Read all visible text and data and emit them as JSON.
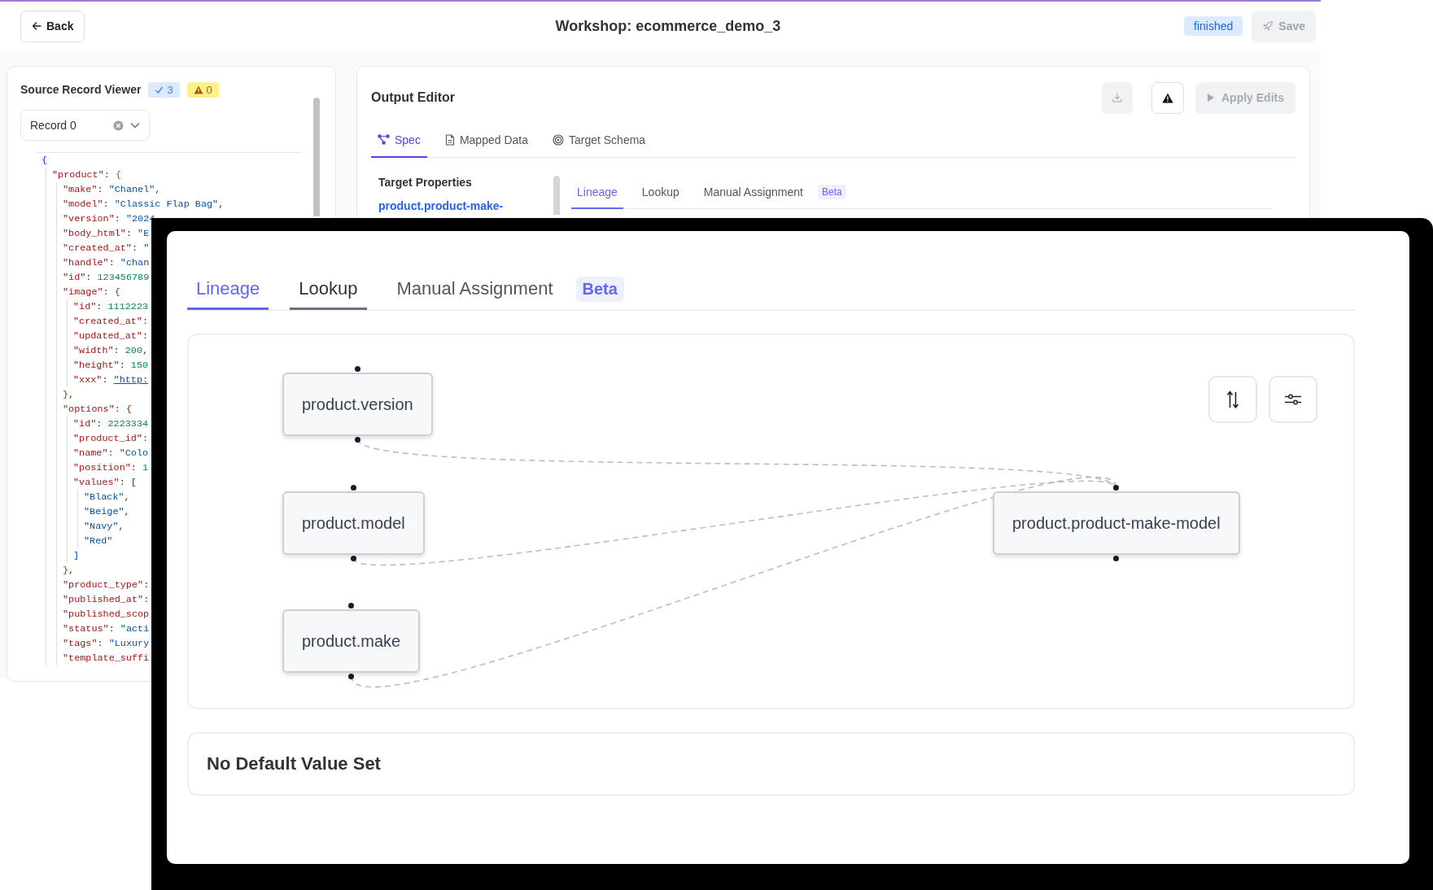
{
  "header": {
    "back": "Back",
    "title": "Workshop: ecommerce_demo_3",
    "status": "finished",
    "save": {
      "label": "Save",
      "disabled": true
    }
  },
  "source_viewer": {
    "title": "Source Record Viewer",
    "valid_count": "3",
    "warning_count": "0",
    "record_select": {
      "value": "Record 0"
    },
    "code": [
      {
        "parts": [
          {
            "kind": "brace",
            "text": "{"
          }
        ],
        "children": [
          {
            "parts": [
              {
                "kind": "key",
                "text": "\"product\""
              },
              {
                "kind": "punct",
                "text": ": "
              },
              {
                "kind": "brace",
                "text": "{"
              }
            ],
            "children": [
              {
                "parts": [
                  {
                    "kind": "key",
                    "text": "\"make\""
                  },
                  {
                    "kind": "punct",
                    "text": ": "
                  },
                  {
                    "kind": "string",
                    "text": "\"Chanel\""
                  },
                  {
                    "kind": "punct",
                    "text": ","
                  }
                ]
              },
              {
                "parts": [
                  {
                    "kind": "key",
                    "text": "\"model\""
                  },
                  {
                    "kind": "punct",
                    "text": ": "
                  },
                  {
                    "kind": "string",
                    "text": "\"Classic Flap Bag\""
                  },
                  {
                    "kind": "punct",
                    "text": ","
                  }
                ]
              },
              {
                "parts": [
                  {
                    "kind": "key",
                    "text": "\"version\""
                  },
                  {
                    "kind": "punct",
                    "text": ": "
                  },
                  {
                    "kind": "string",
                    "text": "\"2024"
                  }
                ]
              },
              {
                "parts": [
                  {
                    "kind": "key",
                    "text": "\"body_html\""
                  },
                  {
                    "kind": "punct",
                    "text": ": "
                  },
                  {
                    "kind": "string",
                    "text": "\"E"
                  }
                ]
              },
              {
                "parts": [
                  {
                    "kind": "key",
                    "text": "\"created_at\""
                  },
                  {
                    "kind": "punct",
                    "text": ": "
                  },
                  {
                    "kind": "string",
                    "text": "\""
                  }
                ]
              },
              {
                "parts": [
                  {
                    "kind": "key",
                    "text": "\"handle\""
                  },
                  {
                    "kind": "punct",
                    "text": ": "
                  },
                  {
                    "kind": "string",
                    "text": "\"chan"
                  }
                ]
              },
              {
                "parts": [
                  {
                    "kind": "key",
                    "text": "\"id\""
                  },
                  {
                    "kind": "punct",
                    "text": ": "
                  },
                  {
                    "kind": "number",
                    "text": "123456789"
                  }
                ]
              },
              {
                "parts": [
                  {
                    "kind": "key",
                    "text": "\"image\""
                  },
                  {
                    "kind": "punct",
                    "text": ": "
                  },
                  {
                    "kind": "brace",
                    "text": "{"
                  }
                ],
                "children": [
                  {
                    "parts": [
                      {
                        "kind": "key",
                        "text": "\"id\""
                      },
                      {
                        "kind": "punct",
                        "text": ": "
                      },
                      {
                        "kind": "number",
                        "text": "1112223"
                      }
                    ]
                  },
                  {
                    "parts": [
                      {
                        "kind": "key",
                        "text": "\"created_at\""
                      },
                      {
                        "kind": "punct",
                        "text": ":"
                      }
                    ]
                  },
                  {
                    "parts": [
                      {
                        "kind": "key",
                        "text": "\"updated_at\""
                      },
                      {
                        "kind": "punct",
                        "text": ":"
                      }
                    ]
                  },
                  {
                    "parts": [
                      {
                        "kind": "key",
                        "text": "\"width\""
                      },
                      {
                        "kind": "punct",
                        "text": ": "
                      },
                      {
                        "kind": "number",
                        "text": "200"
                      },
                      {
                        "kind": "punct",
                        "text": ","
                      }
                    ]
                  },
                  {
                    "parts": [
                      {
                        "kind": "key",
                        "text": "\"height\""
                      },
                      {
                        "kind": "punct",
                        "text": ": "
                      },
                      {
                        "kind": "number",
                        "text": "150"
                      }
                    ]
                  },
                  {
                    "parts": [
                      {
                        "kind": "key",
                        "text": "\"xxx\""
                      },
                      {
                        "kind": "punct",
                        "text": ": "
                      },
                      {
                        "kind": "link",
                        "text": "\"http:"
                      }
                    ]
                  }
                ]
              },
              {
                "parts": [
                  {
                    "kind": "brace",
                    "text": "}"
                  },
                  {
                    "kind": "punct",
                    "text": ","
                  }
                ]
              },
              {
                "parts": [
                  {
                    "kind": "key",
                    "text": "\"options\""
                  },
                  {
                    "kind": "punct",
                    "text": ": "
                  },
                  {
                    "kind": "brace",
                    "text": "{"
                  }
                ],
                "children": [
                  {
                    "parts": [
                      {
                        "kind": "key",
                        "text": "\"id\""
                      },
                      {
                        "kind": "punct",
                        "text": ": "
                      },
                      {
                        "kind": "number",
                        "text": "2223334"
                      }
                    ]
                  },
                  {
                    "parts": [
                      {
                        "kind": "key",
                        "text": "\"product_id\""
                      },
                      {
                        "kind": "punct",
                        "text": ":"
                      }
                    ]
                  },
                  {
                    "parts": [
                      {
                        "kind": "key",
                        "text": "\"name\""
                      },
                      {
                        "kind": "punct",
                        "text": ": "
                      },
                      {
                        "kind": "string",
                        "text": "\"Colo"
                      }
                    ]
                  },
                  {
                    "parts": [
                      {
                        "kind": "key",
                        "text": "\"position\""
                      },
                      {
                        "kind": "punct",
                        "text": ": "
                      },
                      {
                        "kind": "number",
                        "text": "1"
                      }
                    ]
                  },
                  {
                    "parts": [
                      {
                        "kind": "key",
                        "text": "\"values\""
                      },
                      {
                        "kind": "punct",
                        "text": ": "
                      },
                      {
                        "kind": "brace",
                        "text": "["
                      }
                    ],
                    "children": [
                      {
                        "parts": [
                          {
                            "kind": "string",
                            "text": "\"Black\""
                          },
                          {
                            "kind": "punct",
                            "text": ","
                          }
                        ]
                      },
                      {
                        "parts": [
                          {
                            "kind": "string",
                            "text": "\"Beige\""
                          },
                          {
                            "kind": "punct",
                            "text": ","
                          }
                        ]
                      },
                      {
                        "parts": [
                          {
                            "kind": "string",
                            "text": "\"Navy\""
                          },
                          {
                            "kind": "punct",
                            "text": ","
                          }
                        ]
                      },
                      {
                        "parts": [
                          {
                            "kind": "string",
                            "text": "\"Red\""
                          }
                        ]
                      }
                    ]
                  },
                  {
                    "parts": [
                      {
                        "kind": "brace",
                        "text": "]"
                      }
                    ]
                  }
                ]
              },
              {
                "parts": [
                  {
                    "kind": "brace",
                    "text": "}"
                  },
                  {
                    "kind": "punct",
                    "text": ","
                  }
                ]
              },
              {
                "parts": [
                  {
                    "kind": "key",
                    "text": "\"product_type\""
                  },
                  {
                    "kind": "punct",
                    "text": ":"
                  }
                ]
              },
              {
                "parts": [
                  {
                    "kind": "key",
                    "text": "\"published_at\""
                  },
                  {
                    "kind": "punct",
                    "text": ":"
                  }
                ]
              },
              {
                "parts": [
                  {
                    "kind": "key",
                    "text": "\"published_scop"
                  }
                ]
              },
              {
                "parts": [
                  {
                    "kind": "key",
                    "text": "\"status\""
                  },
                  {
                    "kind": "punct",
                    "text": ": "
                  },
                  {
                    "kind": "string",
                    "text": "\"acti"
                  }
                ]
              },
              {
                "parts": [
                  {
                    "kind": "key",
                    "text": "\"tags\""
                  },
                  {
                    "kind": "punct",
                    "text": ": "
                  },
                  {
                    "kind": "string",
                    "text": "\"Luxury"
                  }
                ]
              },
              {
                "parts": [
                  {
                    "kind": "key",
                    "text": "\"template_suffi"
                  }
                ]
              }
            ]
          }
        ]
      }
    ]
  },
  "output_editor": {
    "title": "Output Editor",
    "toolbar": [
      {
        "kind": "download",
        "disabled": true
      },
      {
        "kind": "warning",
        "disabled": false
      },
      {
        "kind": "apply",
        "label": "Apply Edits",
        "disabled": true
      }
    ],
    "tabs": [
      {
        "label": "Spec",
        "selected": true
      },
      {
        "label": "Mapped Data",
        "selected": false
      },
      {
        "label": "Target Schema",
        "selected": false
      }
    ],
    "target_properties": {
      "title": "Target Properties",
      "items": [
        "product.product-make-"
      ]
    },
    "sub_tabs": [
      {
        "label": "Lineage",
        "selected": true
      },
      {
        "label": "Lookup",
        "selected": false
      },
      {
        "label": "Manual Assignment",
        "selected": false,
        "badge": "Beta"
      }
    ]
  },
  "zoom_inset": {
    "tabs": [
      {
        "label": "Lineage",
        "selected": true,
        "hovered": false
      },
      {
        "label": "Lookup",
        "selected": false,
        "hovered": true
      },
      {
        "label": "Manual Assignment",
        "selected": false,
        "hovered": false,
        "badge": "Beta"
      }
    ],
    "diagram": {
      "nodes": [
        {
          "label": "product.version",
          "kind": "source"
        },
        {
          "label": "product.model",
          "kind": "source"
        },
        {
          "label": "product.make",
          "kind": "source"
        },
        {
          "label": "product.product-make-model",
          "kind": "target"
        }
      ]
    },
    "default_value": "No Default Value Set"
  }
}
